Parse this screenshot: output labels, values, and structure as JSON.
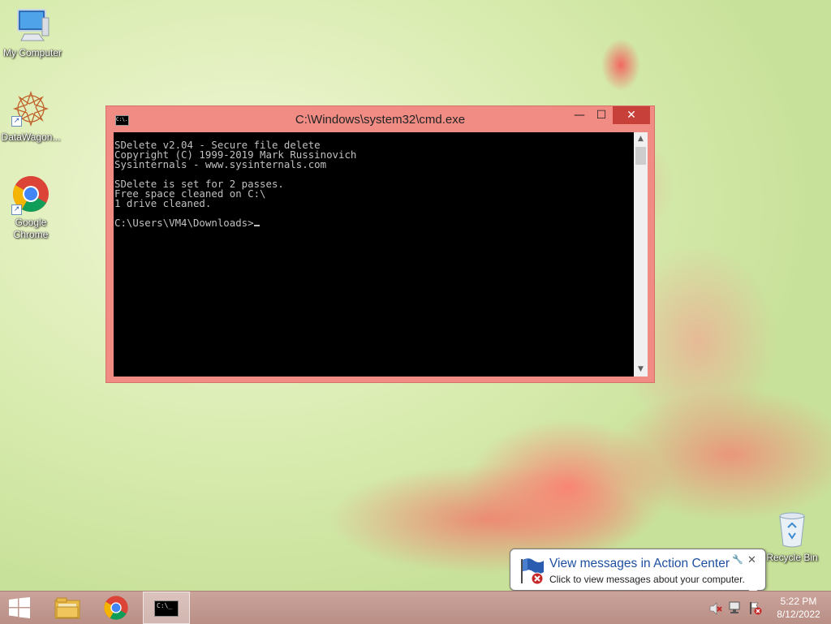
{
  "desktop": {
    "icons": [
      {
        "label": "My Computer"
      },
      {
        "label": "DataWagon..."
      },
      {
        "label": "Google Chrome"
      },
      {
        "label": "Recycle Bin"
      }
    ]
  },
  "cmd_window": {
    "title": "C:\\Windows\\system32\\cmd.exe",
    "app_icon_text": "C:\\.",
    "minimize_glyph": "—",
    "maximize_glyph": "☐",
    "close_glyph": "✕",
    "lines": [
      "SDelete v2.04 - Secure file delete",
      "Copyright (C) 1999-2019 Mark Russinovich",
      "Sysinternals - www.sysinternals.com",
      "",
      "SDelete is set for 2 passes.",
      "Free space cleaned on C:\\",
      "1 drive cleaned.",
      "",
      "C:\\Users\\VM4\\Downloads>"
    ]
  },
  "notification": {
    "title": "View messages in Action Center",
    "message": "Click to view messages about your computer."
  },
  "taskbar": {
    "time": "5:22 PM",
    "date": "8/12/2022",
    "cmd_icon_text": "C:\\_"
  },
  "colors": {
    "window_frame": "#f08c84",
    "close_button": "#c7403a",
    "console_bg": "#000000",
    "console_text": "#c0c0c0",
    "taskbar": "#c29990",
    "notification_title": "#1e4fa0"
  }
}
